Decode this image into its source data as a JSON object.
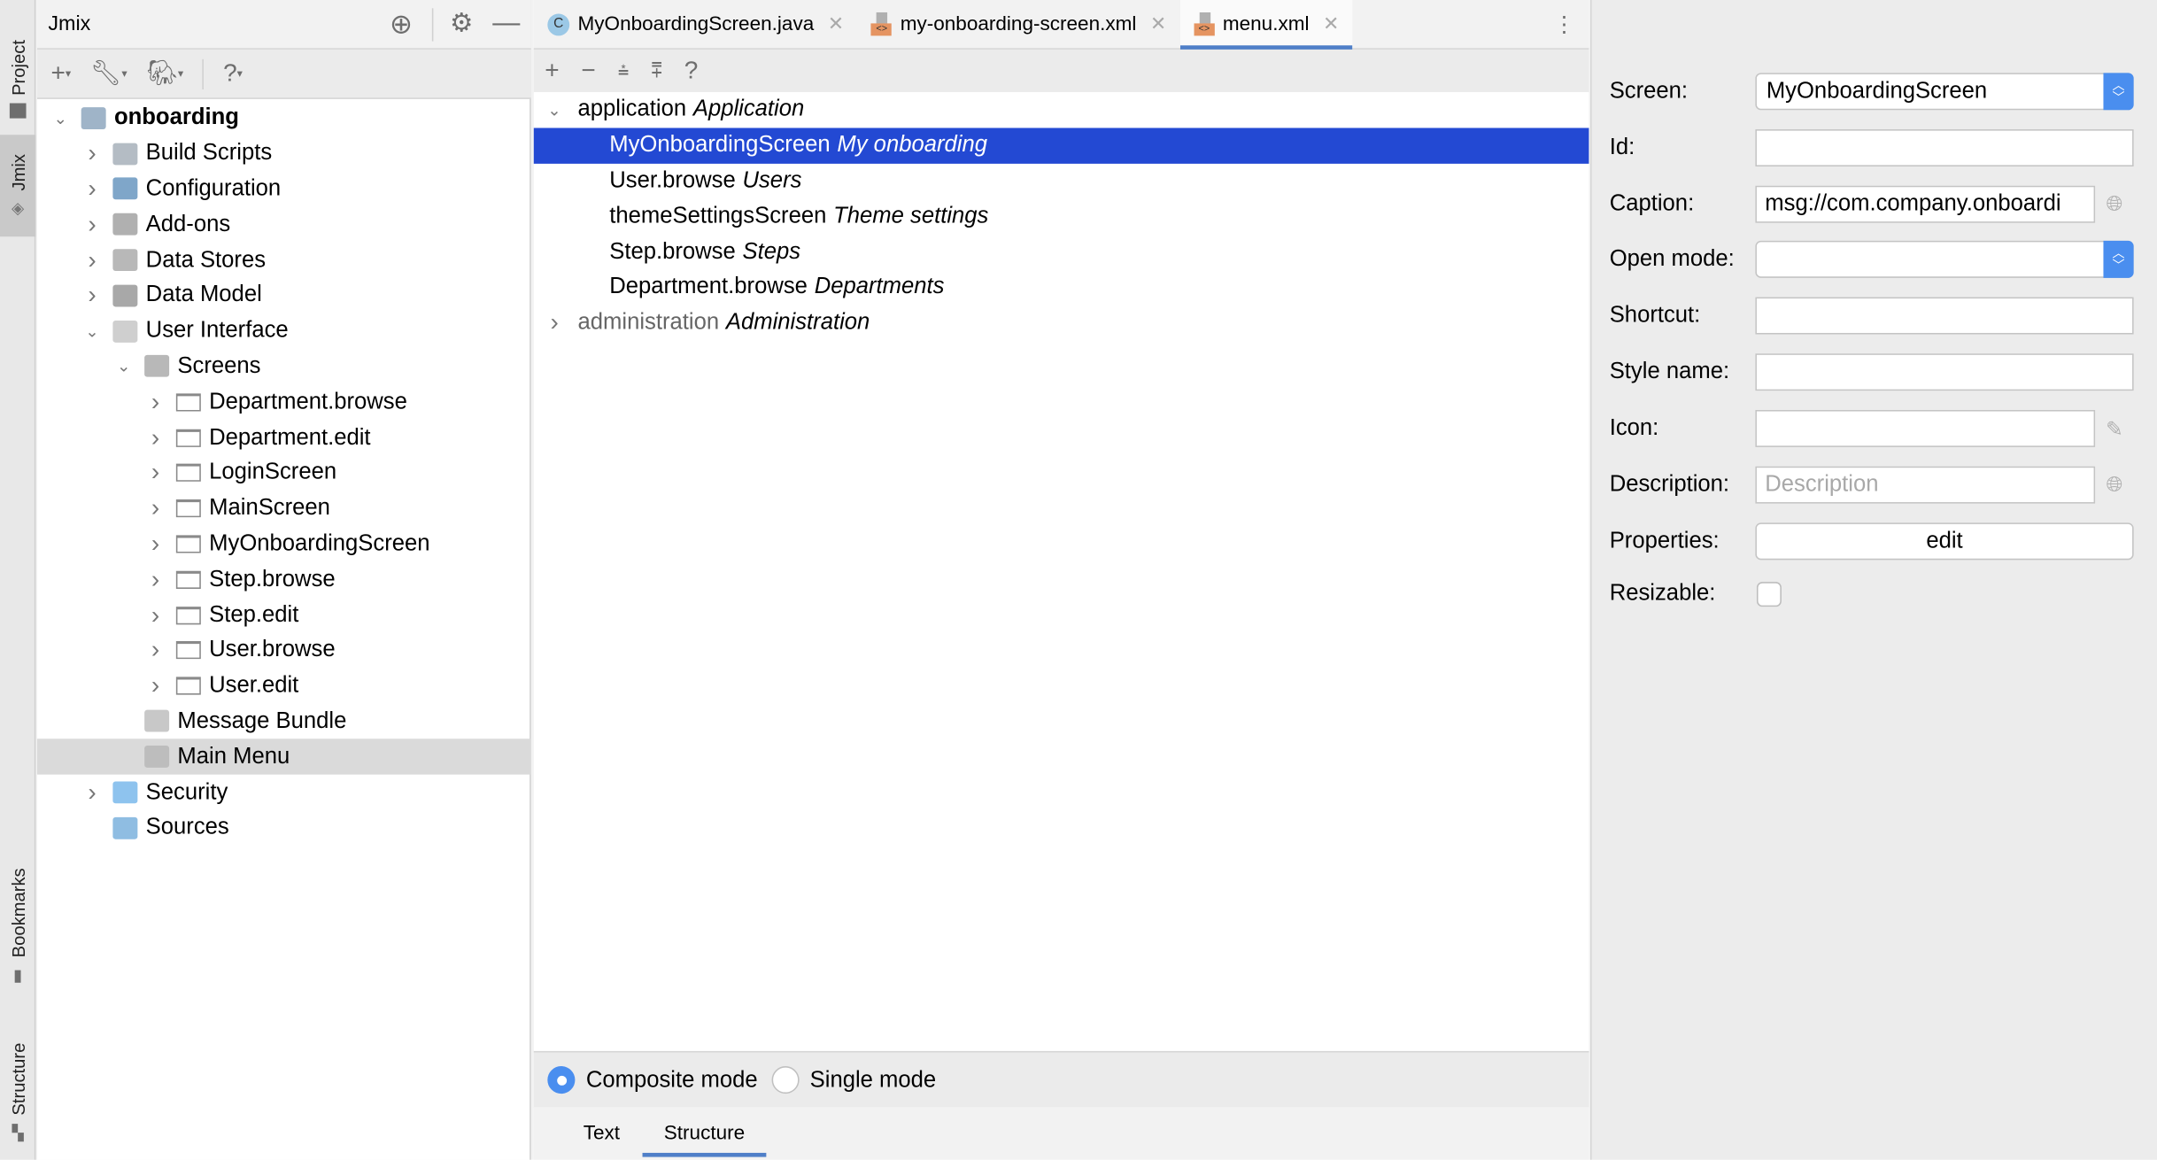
{
  "left_strip": {
    "project": "Project",
    "jmix": "Jmix",
    "bookmarks": "Bookmarks",
    "structure": "Structure"
  },
  "project_panel": {
    "title": "Jmix",
    "tree": [
      {
        "label": "onboarding",
        "level": 0,
        "expanded": true,
        "bold": true
      },
      {
        "label": "Build Scripts",
        "level": 1
      },
      {
        "label": "Configuration",
        "level": 1
      },
      {
        "label": "Add-ons",
        "level": 1
      },
      {
        "label": "Data Stores",
        "level": 1
      },
      {
        "label": "Data Model",
        "level": 1
      },
      {
        "label": "User Interface",
        "level": 1,
        "expanded": true
      },
      {
        "label": "Screens",
        "level": 2,
        "expanded": true
      },
      {
        "label": "Department.browse",
        "level": 3
      },
      {
        "label": "Department.edit",
        "level": 3
      },
      {
        "label": "LoginScreen",
        "level": 3
      },
      {
        "label": "MainScreen",
        "level": 3
      },
      {
        "label": "MyOnboardingScreen",
        "level": 3
      },
      {
        "label": "Step.browse",
        "level": 3
      },
      {
        "label": "Step.edit",
        "level": 3
      },
      {
        "label": "User.browse",
        "level": 3
      },
      {
        "label": "User.edit",
        "level": 3
      },
      {
        "label": "Message Bundle",
        "level": 2
      },
      {
        "label": "Main Menu",
        "level": 2,
        "selected": true
      },
      {
        "label": "Security",
        "level": 1
      },
      {
        "label": "Sources",
        "level": 1
      }
    ]
  },
  "editor": {
    "tabs": [
      {
        "label": "MyOnboardingScreen.java",
        "icon": "java-class-icon"
      },
      {
        "label": "my-onboarding-screen.xml",
        "icon": "xml-file-icon"
      },
      {
        "label": "menu.xml",
        "icon": "xml-file-icon",
        "active": true
      }
    ],
    "menu_tree": [
      {
        "id": "application",
        "caption": "Application",
        "level": 0,
        "expanded": true
      },
      {
        "id": "MyOnboardingScreen",
        "caption": "My onboarding",
        "level": 1,
        "selected": true
      },
      {
        "id": "User.browse",
        "caption": "Users",
        "level": 1
      },
      {
        "id": "themeSettingsScreen",
        "caption": "Theme settings",
        "level": 1
      },
      {
        "id": "Step.browse",
        "caption": "Steps",
        "level": 1
      },
      {
        "id": "Department.browse",
        "caption": "Departments",
        "level": 1
      },
      {
        "id": "administration",
        "caption": "Administration",
        "level": 0,
        "expanded": false
      }
    ],
    "modes": {
      "composite": "Composite mode",
      "single": "Single mode",
      "selected": "composite"
    },
    "bottom_tabs": {
      "text": "Text",
      "structure": "Structure",
      "active": "Structure"
    }
  },
  "properties": {
    "screen": {
      "label": "Screen:",
      "value": "MyOnboardingScreen"
    },
    "id": {
      "label": "Id:",
      "value": ""
    },
    "caption": {
      "label": "Caption:",
      "value": "msg://com.company.onboardi"
    },
    "open_mode": {
      "label": "Open mode:",
      "value": ""
    },
    "shortcut": {
      "label": "Shortcut:",
      "value": ""
    },
    "style_name": {
      "label": "Style name:",
      "value": ""
    },
    "icon": {
      "label": "Icon:",
      "value": ""
    },
    "description": {
      "label": "Description:",
      "value": "",
      "placeholder": "Description"
    },
    "properties": {
      "label": "Properties:",
      "button": "edit"
    },
    "resizable": {
      "label": "Resizable:",
      "checked": false
    }
  },
  "colors": {
    "selection": "#2349d3",
    "accent": "#4a8eef",
    "tab_underline": "#4f7fc8"
  }
}
